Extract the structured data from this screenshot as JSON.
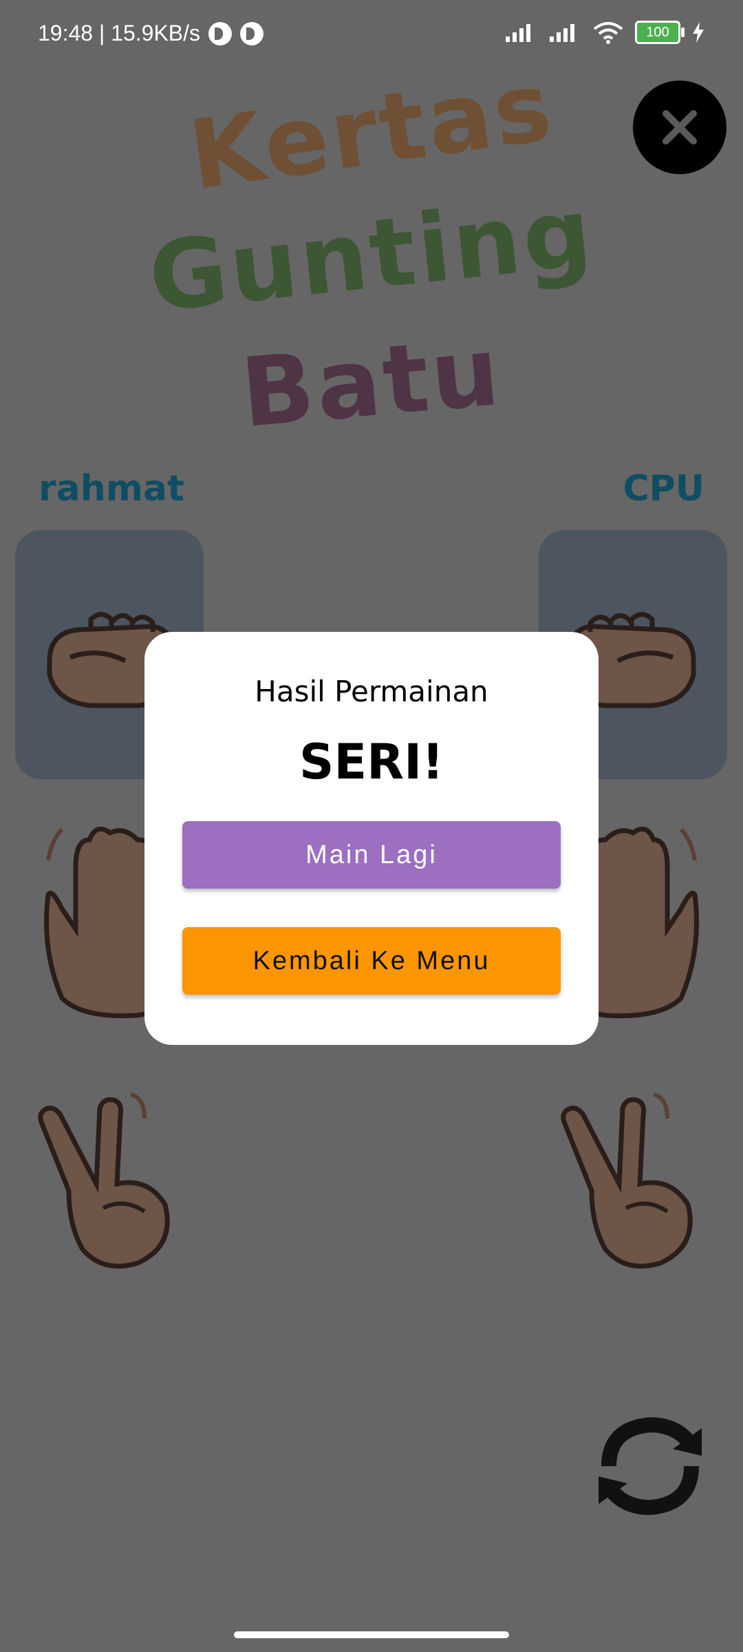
{
  "status_bar": {
    "time_speed": "19:48 | 15.9KB/s",
    "battery": "100"
  },
  "title": {
    "line1": "Kertas",
    "line2": "Gunting",
    "line3": "Batu"
  },
  "players": {
    "left": "rahmat",
    "right": "CPU"
  },
  "dialog": {
    "title": "Hasil Permainan",
    "result": "SERI!",
    "play_again": "Main Lagi",
    "back_to_menu": "Kembali Ke Menu"
  },
  "colors": {
    "overlay_bg": "#666666",
    "play_again_button": "#9c6fc1",
    "menu_button": "#fb9600",
    "player_name": "#0f4d63"
  },
  "icons": [
    "close-icon",
    "fist-icon",
    "palm-icon",
    "peace-icon",
    "refresh-icon",
    "wifi-icon",
    "signal-icon",
    "battery-icon",
    "bolt-icon"
  ]
}
